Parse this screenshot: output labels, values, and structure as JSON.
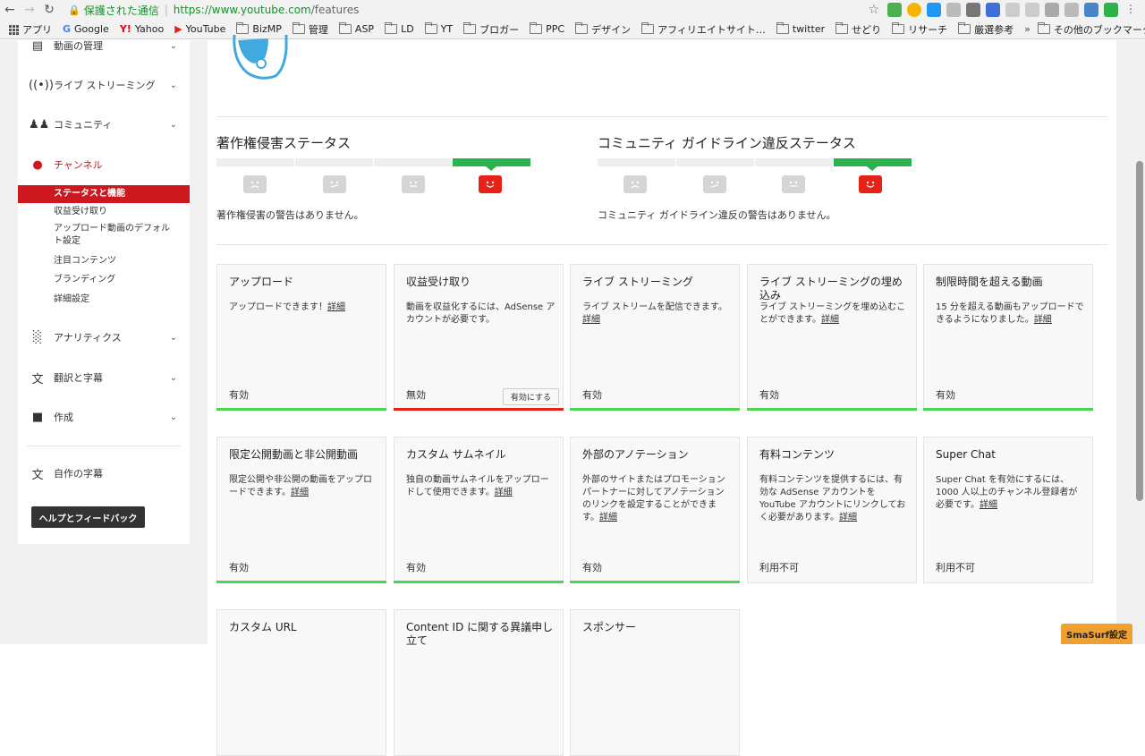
{
  "browser": {
    "secure_label": "保護された通信",
    "url_base": "https://www.youtube.com",
    "url_path": "/features"
  },
  "bookmarks": [
    {
      "label": "アプリ",
      "icon": "apps-grid-icon"
    },
    {
      "label": "Google",
      "icon": "google-icon"
    },
    {
      "label": "Yahoo",
      "icon": "yahoo-icon"
    },
    {
      "label": "YouTube",
      "icon": "youtube-icon"
    },
    {
      "label": "BizMP",
      "icon": "folder-icon"
    },
    {
      "label": "管理",
      "icon": "folder-icon"
    },
    {
      "label": "ASP",
      "icon": "folder-icon"
    },
    {
      "label": "LD",
      "icon": "folder-icon"
    },
    {
      "label": "YT",
      "icon": "folder-icon"
    },
    {
      "label": "ブロガー",
      "icon": "folder-icon"
    },
    {
      "label": "PPC",
      "icon": "folder-icon"
    },
    {
      "label": "デザイン",
      "icon": "folder-icon"
    },
    {
      "label": "アフィリエイトサイト…",
      "icon": "folder-icon"
    },
    {
      "label": "twitter",
      "icon": "folder-icon"
    },
    {
      "label": "せどり",
      "icon": "folder-icon"
    },
    {
      "label": "リサーチ",
      "icon": "folder-icon"
    },
    {
      "label": "厳選参考",
      "icon": "folder-icon"
    }
  ],
  "bookmarks_more": "»",
  "bookmarks_other": "その他のブックマーク",
  "sidebar": {
    "items": [
      {
        "label": "動画の管理",
        "icon": "video-manager-icon"
      },
      {
        "label": "ライブ ストリーミング",
        "icon": "live-stream-icon"
      },
      {
        "label": "コミュニティ",
        "icon": "community-icon"
      },
      {
        "label": "チャンネル",
        "icon": "channel-icon"
      },
      {
        "label": "アナリティクス",
        "icon": "analytics-icon"
      },
      {
        "label": "翻訳と字幕",
        "icon": "translate-icon"
      },
      {
        "label": "作成",
        "icon": "create-icon"
      },
      {
        "label": "自作の字幕",
        "icon": "subtitles-icon"
      }
    ],
    "channel_sub": [
      "ステータスと機能",
      "収益受け取り",
      "アップロード動画のデフォルト設定",
      "注目コンテンツ",
      "ブランディング",
      "詳細設定"
    ],
    "help_button": "ヘルプとフィードバック"
  },
  "status": {
    "copyright": {
      "title": "著作権侵害ステータス",
      "message": "著作権侵害の警告はありません。"
    },
    "guidelines": {
      "title": "コミュニティ ガイドライン違反ステータス",
      "message": "コミュニティ ガイドライン違反の警告はありません。"
    }
  },
  "features": [
    {
      "title": "アップロード",
      "desc": "アップロードできます！",
      "link": "詳細",
      "status": "有効",
      "bar": "green"
    },
    {
      "title": "収益受け取り",
      "desc": "動画を収益化するには、AdSense アカウントが必要です。",
      "link": "",
      "status": "無効",
      "bar": "red",
      "button": "有効にする"
    },
    {
      "title": "ライブ ストリーミング",
      "desc": "ライブ ストリームを配信できます。",
      "link": "詳細",
      "status": "有効",
      "bar": "green"
    },
    {
      "title": "ライブ ストリーミングの埋め込み",
      "desc": "ライブ ストリーミングを埋め込むことができます。",
      "link": "詳細",
      "status": "有効",
      "bar": "green"
    },
    {
      "title": "制限時間を超える動画",
      "desc": "15 分を超える動画もアップロードできるようになりました。",
      "link": "詳細",
      "status": "有効",
      "bar": "green"
    },
    {
      "title": "限定公開動画と非公開動画",
      "desc": "限定公開や非公開の動画をアップロードできます。",
      "link": "詳細",
      "status": "有効",
      "bar": "green"
    },
    {
      "title": "カスタム サムネイル",
      "desc": "独自の動画サムネイルをアップロードして使用できます。",
      "link": "詳細",
      "status": "有効",
      "bar": "green"
    },
    {
      "title": "外部のアノテーション",
      "desc": "外部のサイトまたはプロモーション パートナーに対してアノテーションのリンクを設定することができます。",
      "link": "詳細",
      "status": "有効",
      "bar": "green"
    },
    {
      "title": "有料コンテンツ",
      "desc": "有料コンテンツを提供するには、有効な AdSense アカウントを YouTube アカウントにリンクしておく必要があります。",
      "link": "詳細",
      "status": "利用不可",
      "bar": "none"
    },
    {
      "title": "Super Chat",
      "desc": "Super Chat を有効にするには、1000 人以上のチャンネル登録者が必要です。",
      "link": "詳細",
      "status": "利用不可",
      "bar": "none"
    },
    {
      "title": "カスタム URL",
      "desc": "",
      "link": "",
      "status": "",
      "bar": "none"
    },
    {
      "title": "Content ID に関する異議申し立て",
      "desc": "",
      "link": "",
      "status": "",
      "bar": "none"
    },
    {
      "title": "スポンサー",
      "desc": "",
      "link": "",
      "status": "",
      "bar": "none"
    }
  ],
  "smasurf": "SmaSurf設定",
  "colors": {
    "accent_red": "#cc181e",
    "enabled_green": "#4cd552",
    "meter_green": "#2bb24c"
  }
}
